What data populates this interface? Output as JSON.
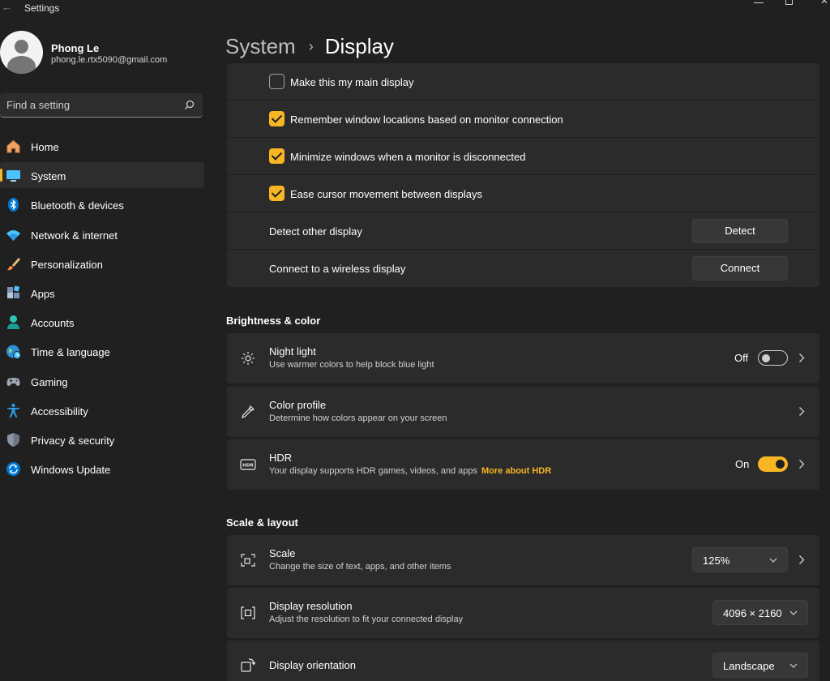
{
  "window": {
    "title": "Settings"
  },
  "user": {
    "name": "Phong Le",
    "email": "phong.le.rtx5090@gmail.com"
  },
  "search": {
    "placeholder": "Find a setting"
  },
  "nav": [
    {
      "label": "Home",
      "icon": "home-icon"
    },
    {
      "label": "System",
      "icon": "system-icon",
      "active": true
    },
    {
      "label": "Bluetooth & devices",
      "icon": "bluetooth-icon"
    },
    {
      "label": "Network & internet",
      "icon": "wifi-icon"
    },
    {
      "label": "Personalization",
      "icon": "brush-icon"
    },
    {
      "label": "Apps",
      "icon": "apps-icon"
    },
    {
      "label": "Accounts",
      "icon": "person-icon"
    },
    {
      "label": "Time & language",
      "icon": "globe-icon"
    },
    {
      "label": "Gaming",
      "icon": "controller-icon"
    },
    {
      "label": "Accessibility",
      "icon": "accessibility-icon"
    },
    {
      "label": "Privacy & security",
      "icon": "shield-icon"
    },
    {
      "label": "Windows Update",
      "icon": "update-icon"
    }
  ],
  "breadcrumb": {
    "parent": "System",
    "current": "Display"
  },
  "multiple_displays": {
    "checkboxes": [
      {
        "label": "Make this my main display",
        "checked": false
      },
      {
        "label": "Remember window locations based on monitor connection",
        "checked": true
      },
      {
        "label": "Minimize windows when a monitor is disconnected",
        "checked": true
      },
      {
        "label": "Ease cursor movement between displays",
        "checked": true
      }
    ],
    "detect": {
      "label": "Detect other display",
      "button": "Detect"
    },
    "wireless": {
      "label": "Connect to a wireless display",
      "button": "Connect"
    }
  },
  "brightness_color": {
    "title": "Brightness & color",
    "night_light": {
      "title": "Night light",
      "subtitle": "Use warmer colors to help block blue light",
      "state": "Off"
    },
    "color_profile": {
      "title": "Color profile",
      "subtitle": "Determine how colors appear on your screen"
    },
    "hdr": {
      "title": "HDR",
      "subtitle": "Your display supports HDR games, videos, and apps",
      "link": "More about HDR",
      "state": "On"
    }
  },
  "scale_layout": {
    "title": "Scale & layout",
    "scale": {
      "title": "Scale",
      "subtitle": "Change the size of text, apps, and other items",
      "value": "125%"
    },
    "resolution": {
      "title": "Display resolution",
      "subtitle": "Adjust the resolution to fit your connected display",
      "value": "4096 × 2160"
    },
    "orientation": {
      "title": "Display orientation",
      "value": "Landscape"
    }
  },
  "colors": {
    "accent": "#f8b624",
    "background": "#202020",
    "card": "#2b2b2b"
  }
}
